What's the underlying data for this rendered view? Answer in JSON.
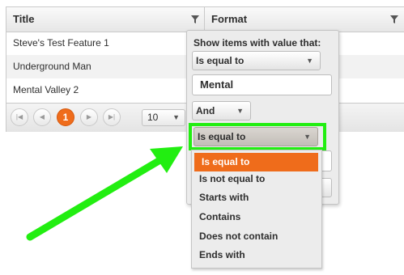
{
  "grid": {
    "columns": [
      "Title",
      "Format"
    ],
    "rows": [
      "Steve's Test Feature 1",
      "Underground Man",
      "Mental Valley 2"
    ],
    "pager": {
      "current_page": "1",
      "page_size": "10"
    }
  },
  "filter": {
    "heading": "Show items with value that:",
    "operator1": "Is equal to",
    "value1": "Mental",
    "logic": "And",
    "operator2": "Is equal to",
    "options": [
      "Is equal to",
      "Is not equal to",
      "Starts with",
      "Contains",
      "Does not contain",
      "Ends with"
    ]
  },
  "colors": {
    "accent": "#ef6c1b",
    "highlight": "#22ee11"
  },
  "icons": [
    "filter-icon",
    "first-page-icon",
    "previous-page-icon",
    "next-page-icon",
    "last-page-icon",
    "caret-down-icon",
    "arrow-icon"
  ]
}
